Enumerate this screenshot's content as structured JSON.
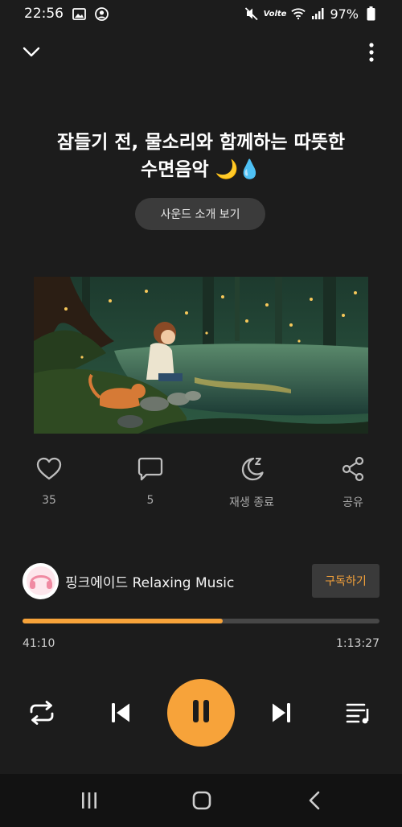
{
  "status_bar": {
    "time": "22:56",
    "network_label": "Volte",
    "battery": "97%",
    "icons": [
      "gallery-icon",
      "account-circle-icon",
      "mute-icon",
      "wifi-icon",
      "signal-icon",
      "battery-icon"
    ]
  },
  "header": {
    "collapse_icon": "chevron-down-icon",
    "more_icon": "more-vert-icon"
  },
  "track": {
    "title_line1": "잠들기 전, 물소리와 함께하는 따뜻한",
    "title_line2": "수면음악 🌙💧",
    "intro_button": "사운드 소개 보기",
    "artwork_description_icon": "album-art"
  },
  "actions": [
    {
      "icon": "heart-icon",
      "label": "35"
    },
    {
      "icon": "comment-icon",
      "label": "5"
    },
    {
      "icon": "sleep-timer-icon",
      "label": "재생 종료"
    },
    {
      "icon": "share-icon",
      "label": "공유"
    }
  ],
  "channel": {
    "name": "핑크에이드 Relaxing Music",
    "subscribe_label": "구독하기"
  },
  "playback": {
    "current_time": "41:10",
    "total_time": "1:13:27",
    "progress_fraction": 0.56
  },
  "controls": {
    "repeat_icon": "repeat-icon",
    "prev_icon": "skip-previous-icon",
    "play_icon": "pause-icon",
    "next_icon": "skip-next-icon",
    "queue_icon": "playlist-icon"
  },
  "colors": {
    "accent": "#f7a33a",
    "background": "#1c1c1c",
    "nav_background": "#121212"
  }
}
